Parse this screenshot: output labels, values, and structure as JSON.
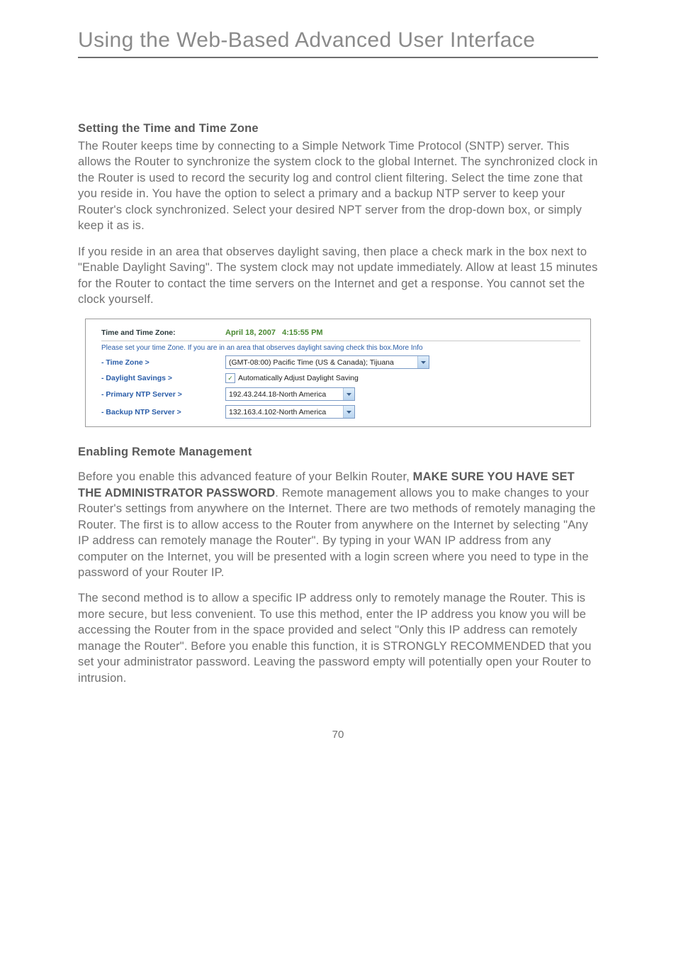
{
  "page": {
    "title": "Using the Web-Based Advanced User Interface",
    "number": "70"
  },
  "section1": {
    "heading": "Setting the Time and Time Zone",
    "p1": "The Router keeps time by connecting to a Simple Network Time Protocol (SNTP) server. This allows the Router to synchronize the system clock to the global Internet. The synchronized clock in the Router is used to record the security log and control client filtering. Select the time zone that you reside in. You have the option to select a primary and a backup NTP server to keep your Router's clock synchronized. Select your desired NPT server from the drop-down box, or simply keep it as is.",
    "p2": "If you reside in an area that observes daylight saving, then place a check mark in the box next to \"Enable Daylight Saving\". The system clock may not update immediately. Allow at least 15 minutes for the Router to contact the time servers on the Internet and get a response. You cannot set the clock yourself."
  },
  "figure": {
    "header_label": "Time and Time Zone:",
    "header_value": "April 18, 2007   4:15:55 PM",
    "note": "Please set your time Zone. If you are in an area that observes daylight saving check this box.More Info",
    "rows": {
      "timezone": {
        "label": "- Time Zone >",
        "value": "(GMT-08:00) Pacific Time (US & Canada); Tijuana"
      },
      "daylight": {
        "label": "- Daylight Savings >",
        "value": "Automatically Adjust Daylight Saving"
      },
      "primary": {
        "label": "- Primary NTP Server >",
        "value": "192.43.244.18-North America"
      },
      "backup": {
        "label": "- Backup NTP Server >",
        "value": "132.163.4.102-North America"
      }
    }
  },
  "section2": {
    "heading": "Enabling Remote Management",
    "p1_a": "Before you enable this advanced feature of your Belkin Router, ",
    "p1_strong": "MAKE SURE YOU HAVE SET THE ADMINISTRATOR PASSWORD",
    "p1_b": ". Remote management allows you to make changes to your Router's settings from anywhere on the Internet. There are two methods of remotely managing the Router. The first is to allow access to the Router from anywhere on the Internet by selecting \"Any IP address can remotely manage the Router\". By typing in your WAN IP address from any computer on the Internet, you will be presented with a login screen where you need to type in the password of your Router IP.",
    "p2": "The second method is to allow a specific IP address only to remotely manage the Router. This is more secure, but less convenient. To use this method, enter the IP address you know you will be accessing the Router from in the space provided and select \"Only this IP address can remotely manage the Router\". Before you enable this function, it is STRONGLY RECOMMENDED that you set your administrator password. Leaving the password empty will potentially open your Router to intrusion."
  }
}
